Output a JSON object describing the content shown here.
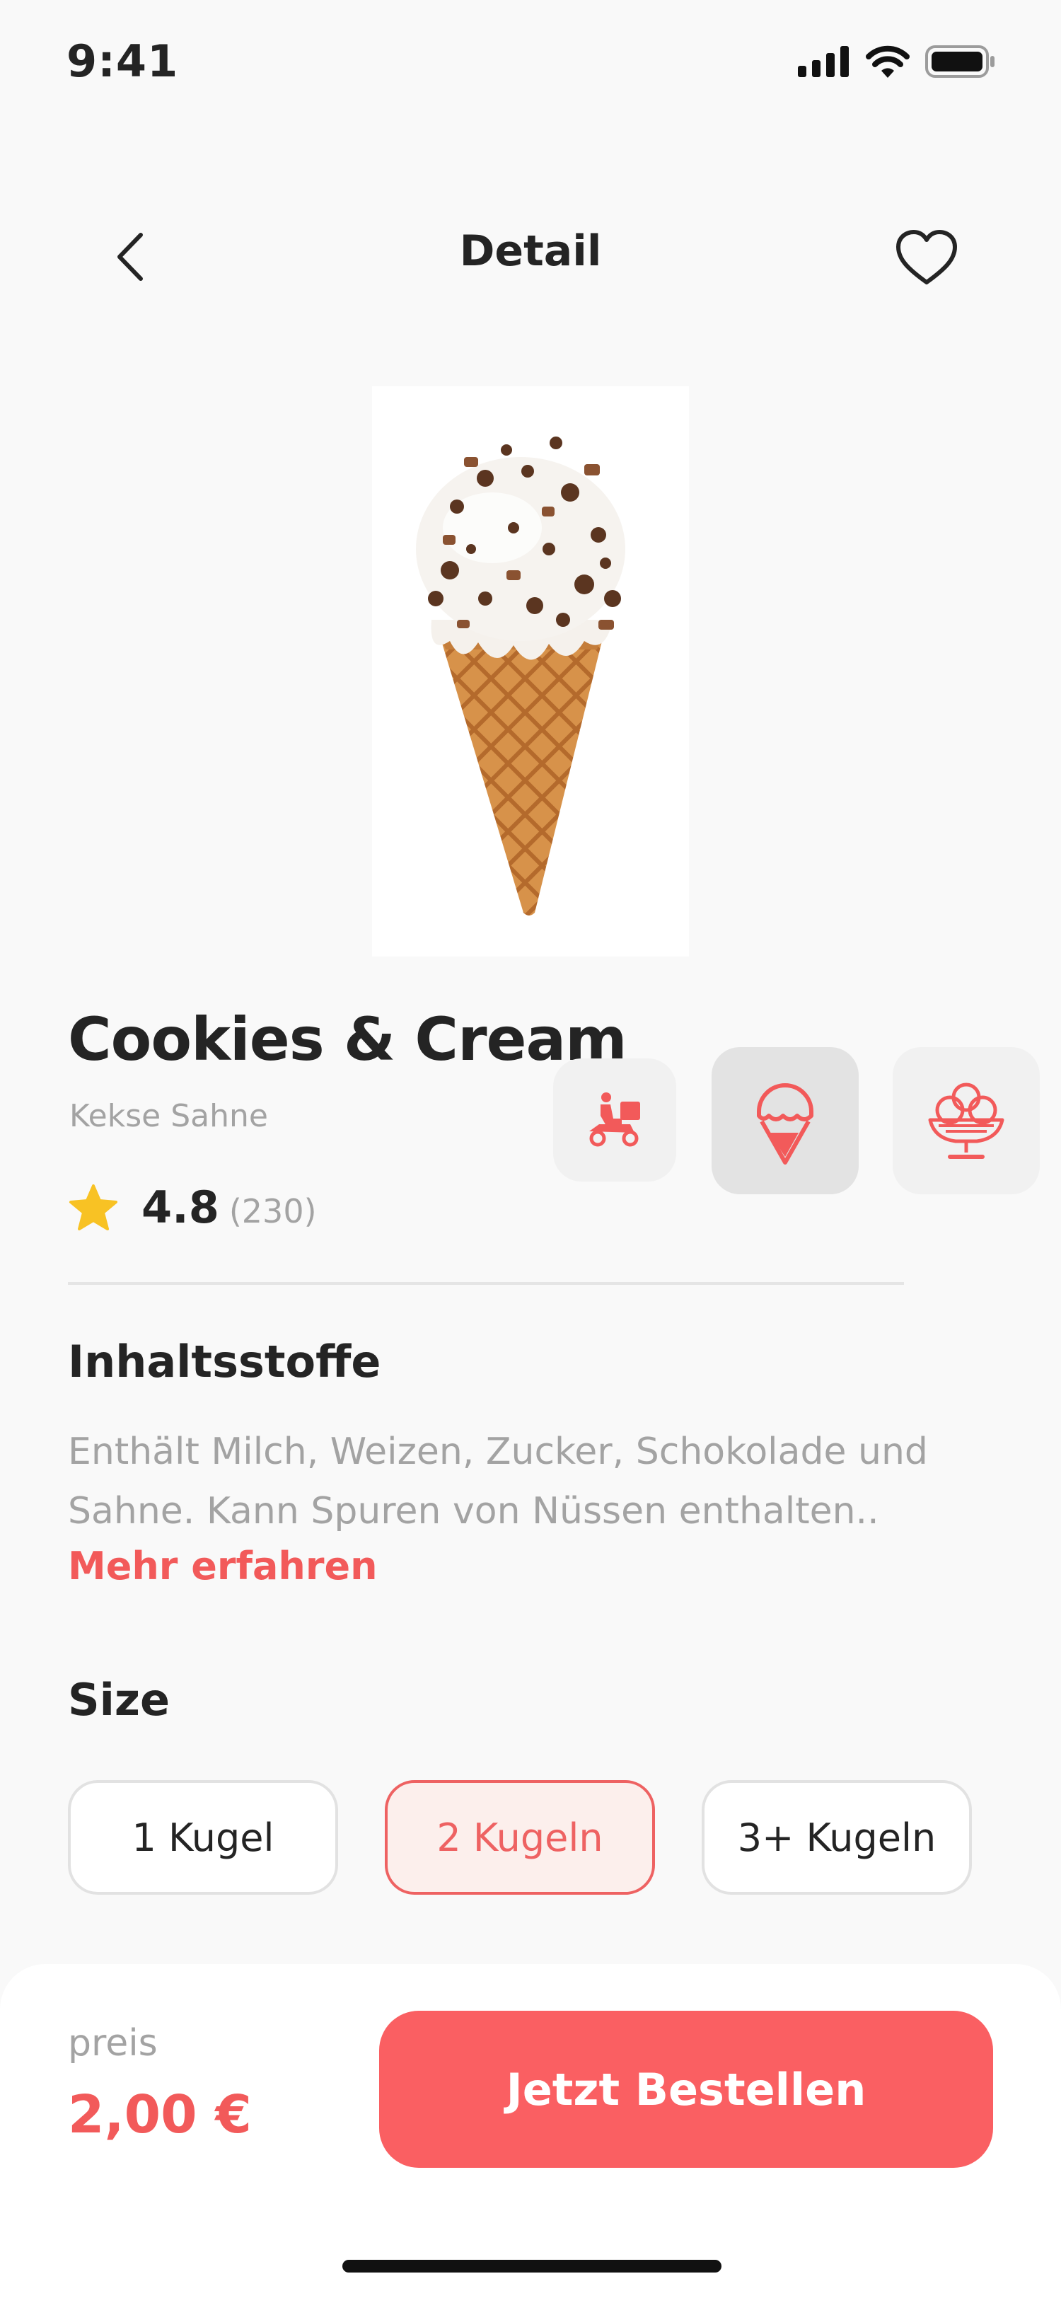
{
  "status_bar": {
    "time": "9:41"
  },
  "header": {
    "title": "Detail"
  },
  "product": {
    "name": "Cookies & Cream",
    "subtitle": "Kekse Sahne",
    "rating": "4.8",
    "rating_count": "(230)"
  },
  "ingredients": {
    "title": "Inhaltsstoffe",
    "text": "Enthält Milch, Weizen, Zucker, Schokolade und Sahne. Kann Spuren von Nüssen enthalten..",
    "more_link": "Mehr erfahren"
  },
  "size": {
    "title": "Size",
    "options": [
      "1 Kugel",
      "2 Kugeln",
      "3+ Kugeln"
    ],
    "selected": "2 Kugeln"
  },
  "footer": {
    "price_label": "preis",
    "price_value": "2,00 €",
    "order_button": "Jetzt Bestellen"
  },
  "icons": {
    "back": "chevron-left-icon",
    "favorite": "heart-icon",
    "rating": "star-icon",
    "serving": [
      "delivery-scooter-icon",
      "ice-cream-cone-icon",
      "ice-cream-cup-icon"
    ]
  },
  "colors": {
    "accent": "#FA5F62",
    "accent_text": "#F25A5A",
    "star": "#F8C224",
    "background": "#F9F9F9"
  }
}
